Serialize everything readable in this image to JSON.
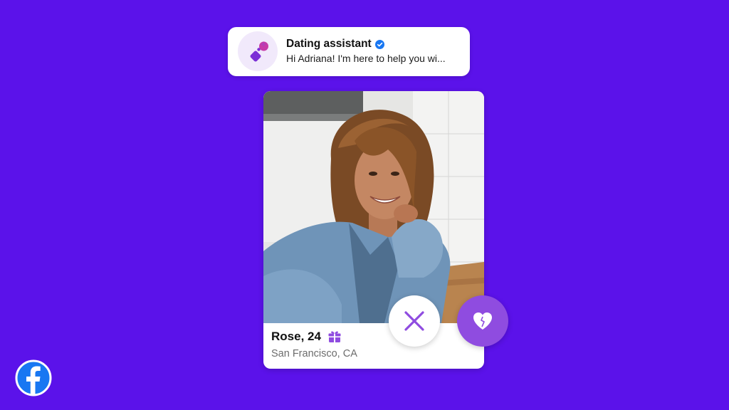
{
  "assistant": {
    "title": "Dating assistant",
    "message": "Hi Adriana! I'm here to help you wi...",
    "icon": "sparkle-icon",
    "verified_icon": "verified-badge-icon"
  },
  "profile": {
    "name_age": "Rose, 24",
    "location": "San Francisco, CA",
    "badge_icon": "gift-icon",
    "photo": "profile-photo"
  },
  "actions": {
    "pass_icon": "close-icon",
    "like_icon": "heart-icon"
  },
  "branding": {
    "logo": "facebook-logo"
  },
  "colors": {
    "background": "#5b12ea",
    "accent": "#8f4ce0",
    "verified": "#1877f2"
  }
}
